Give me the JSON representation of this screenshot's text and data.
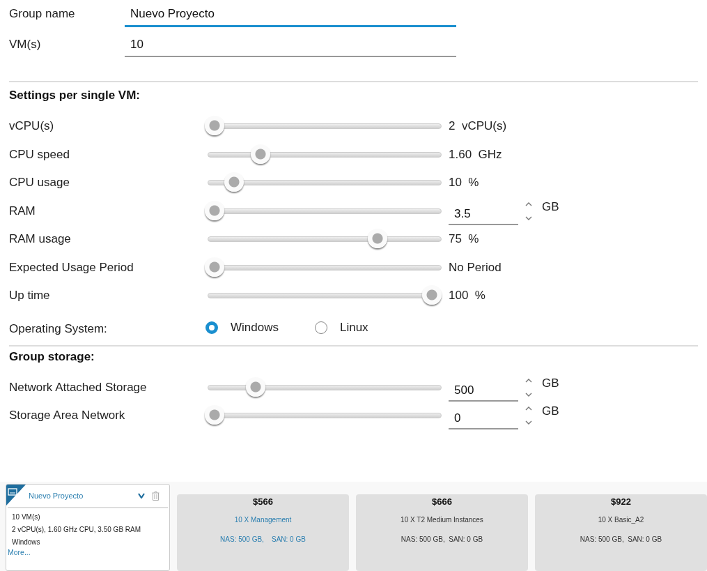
{
  "group_fields": [
    {
      "label": "Group name",
      "value": "Nuevo Proyecto",
      "focused": true
    },
    {
      "label": "VM(s)",
      "value": "10",
      "focused": false
    }
  ],
  "settings": {
    "heading": "Settings per single VM:",
    "rows": [
      {
        "kind": "slider",
        "label": "vCPU(s)",
        "level": 0.0,
        "reading": "2  vCPU(s)"
      },
      {
        "kind": "slider",
        "label": "CPU speed",
        "level": 0.21,
        "reading": "1.60  GHz"
      },
      {
        "kind": "slider",
        "label": "CPU usage",
        "level": 0.09,
        "reading": "10  %"
      },
      {
        "kind": "number",
        "label": "RAM",
        "level": 0.0,
        "value": "3.5",
        "unit": "GB"
      },
      {
        "kind": "slider",
        "label": "RAM usage",
        "level": 0.75,
        "reading": "75  %"
      },
      {
        "kind": "slider",
        "label": "Expected Usage Period",
        "level": 0.0,
        "reading": "No Period"
      },
      {
        "kind": "slider",
        "label": "Up time",
        "level": 1.0,
        "reading": "100  %"
      }
    ],
    "operating_system": {
      "label": "Operating System:",
      "options": [
        {
          "label": "Windows",
          "selected": true
        },
        {
          "label": "Linux",
          "selected": false
        }
      ]
    }
  },
  "storage": {
    "heading": "Group storage:",
    "rows": [
      {
        "kind": "number",
        "label": "Network Attached Storage",
        "level": 0.19,
        "value": "500",
        "unit": "GB"
      },
      {
        "kind": "number",
        "label": "Storage Area Network",
        "level": 0.0,
        "value": "0",
        "unit": "GB"
      }
    ]
  },
  "group_card": {
    "title": "Nuevo Proyecto",
    "lines": [
      "10 VM(s)",
      "2 vCPU(s), 1.60 GHz CPU, 3.50 GB RAM",
      "Windows"
    ],
    "more_link": "More..."
  },
  "price_cards": [
    {
      "price": "$566",
      "instances": "10 X Management",
      "storage": "NAS: 500 GB,    SAN: 0 GB",
      "selected": true
    },
    {
      "price": "$666",
      "instances": "10 X T2 Medium Instances",
      "storage": "NAS: 500 GB,  SAN: 0 GB",
      "selected": false
    },
    {
      "price": "$922",
      "instances": "10 X Basic_A2",
      "storage": "NAS: 500 GB,  SAN: 0 GB",
      "selected": false
    }
  ]
}
